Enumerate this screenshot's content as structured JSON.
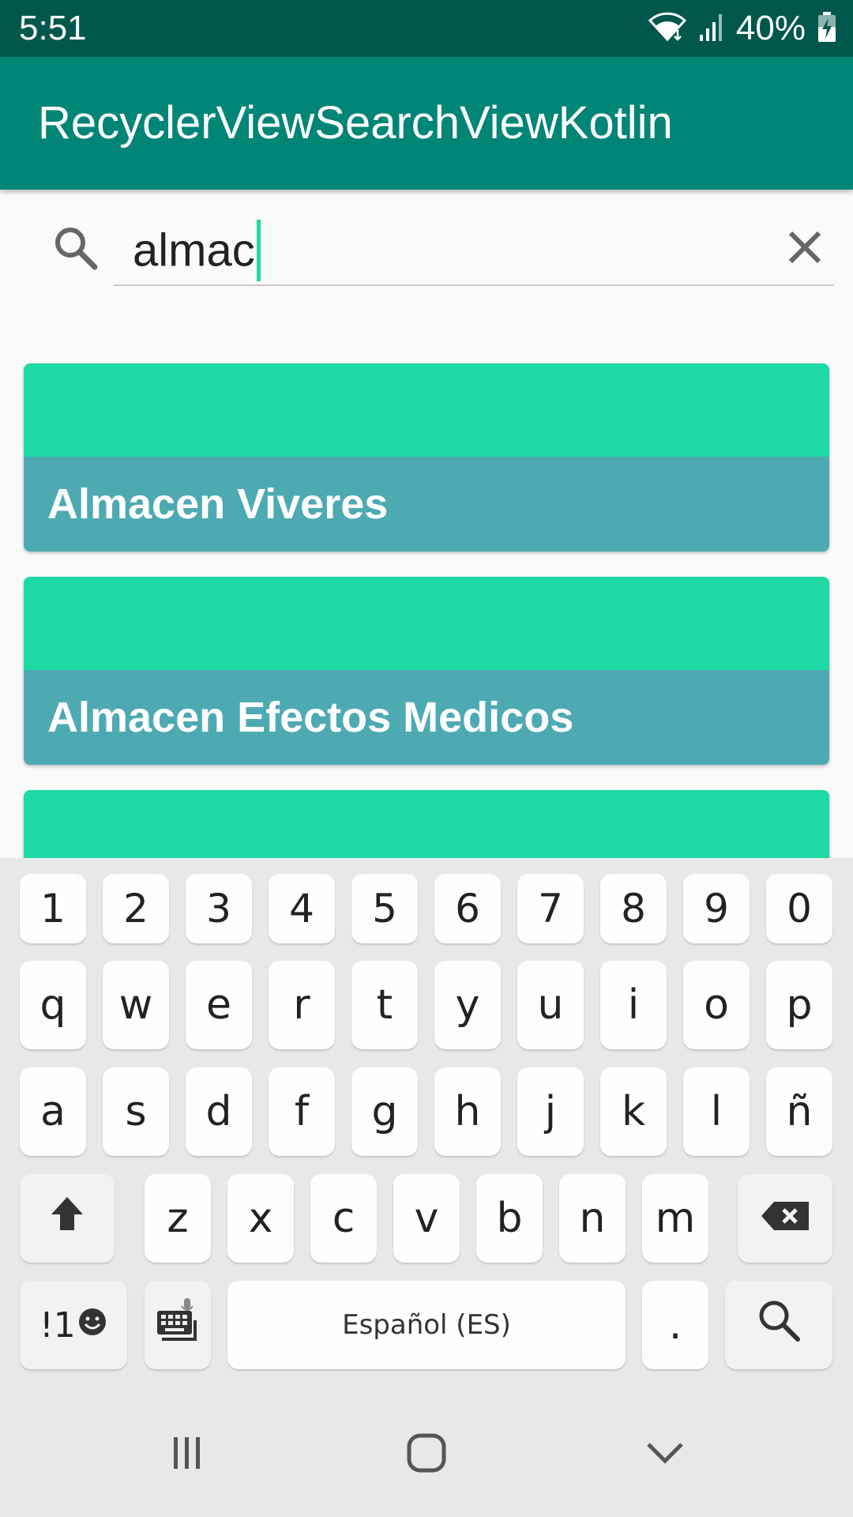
{
  "status_bar": {
    "time": "5:51",
    "battery": "40%",
    "icons": [
      "wifi-icon",
      "signal-icon",
      "battery-charging-icon"
    ]
  },
  "app_bar": {
    "title": "RecyclerViewSearchViewKotlin"
  },
  "search": {
    "value": "almac"
  },
  "list": {
    "items": [
      {
        "label": "Almacen Viveres"
      },
      {
        "label": "Almacen Efectos Medicos"
      },
      {
        "label": ""
      }
    ]
  },
  "keyboard": {
    "number_row": [
      "1",
      "2",
      "3",
      "4",
      "5",
      "6",
      "7",
      "8",
      "9",
      "0"
    ],
    "row1": [
      "q",
      "w",
      "e",
      "r",
      "t",
      "y",
      "u",
      "i",
      "o",
      "p"
    ],
    "row2": [
      "a",
      "s",
      "d",
      "f",
      "g",
      "h",
      "j",
      "k",
      "l",
      "ñ"
    ],
    "row3": [
      "z",
      "x",
      "c",
      "v",
      "b",
      "n",
      "m"
    ],
    "symbols_label": "!1",
    "space_label": "Español (ES)",
    "period_label": ".",
    "icons": [
      "shift-icon",
      "backspace-icon",
      "emoji-icon",
      "keyboard-voice-icon",
      "search-key-icon"
    ]
  },
  "colors": {
    "status_bar": "#00574b",
    "app_bar": "#008577",
    "card_top": "#1dd9a3",
    "card_bottom": "#4daab3",
    "keyboard_bg": "#e8e8e8"
  },
  "nav_bar": {
    "icons": [
      "recents-icon",
      "home-icon",
      "back-icon"
    ]
  }
}
